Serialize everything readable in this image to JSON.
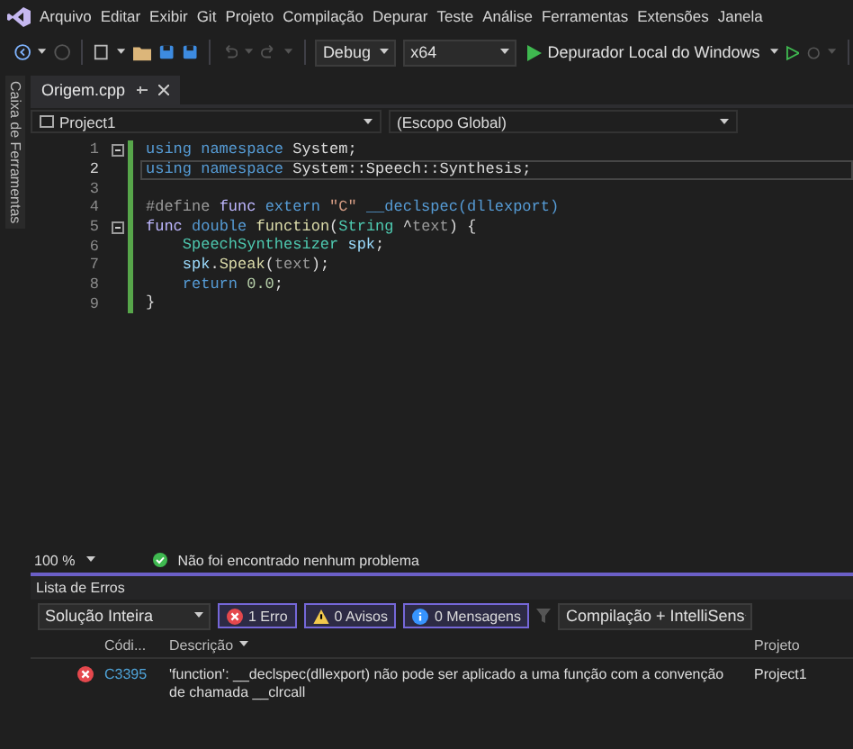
{
  "menu": [
    "Arquivo",
    "Editar",
    "Exibir",
    "Git",
    "Projeto",
    "Compilação",
    "Depurar",
    "Teste",
    "Análise",
    "Ferramentas",
    "Extensões",
    "Janela"
  ],
  "toolbar": {
    "configuration": "Debug",
    "platform": "x64",
    "run_target": "Depurador Local do Windows"
  },
  "side_panel": {
    "label": "Caixa de Ferramentas"
  },
  "tabs": [
    {
      "label": "Origem.cpp",
      "selected": true
    }
  ],
  "navigation": {
    "project": "Project1",
    "scope": "(Escopo Global)"
  },
  "code": [
    {
      "number": "1",
      "foldable": true,
      "current": false,
      "tokens": [
        {
          "kind": "keyword",
          "text": "using "
        },
        {
          "kind": "keyword",
          "text": "namespace "
        },
        {
          "kind": "plain",
          "text": "System;"
        }
      ]
    },
    {
      "number": "2",
      "foldable": false,
      "current": true,
      "tokens": [
        {
          "kind": "keyword",
          "text": "using "
        },
        {
          "kind": "keyword",
          "text": "namespace "
        },
        {
          "kind": "plain",
          "text": "System::Speech::Synthesis;"
        }
      ]
    },
    {
      "number": "3",
      "foldable": false,
      "current": false
    },
    {
      "number": "4",
      "foldable": false,
      "current": false,
      "tokens": [
        {
          "kind": "preprocessor",
          "text": "#define "
        },
        {
          "kind": "macro",
          "text": "func "
        },
        {
          "kind": "keyword",
          "text": "extern "
        },
        {
          "kind": "string",
          "text": "\"C\" "
        },
        {
          "kind": "keyword",
          "text": "__declspec(dllexport)"
        }
      ]
    },
    {
      "number": "5",
      "foldable": true,
      "current": false,
      "tokens": [
        {
          "kind": "macro",
          "text": "func "
        },
        {
          "kind": "keyword",
          "text": "double "
        },
        {
          "kind": "function",
          "text": "function"
        },
        {
          "kind": "plain",
          "text": "("
        },
        {
          "kind": "type",
          "text": "String "
        },
        {
          "kind": "plain",
          "text": "^"
        },
        {
          "kind": "param",
          "text": "text"
        },
        {
          "kind": "plain",
          "text": ") {"
        }
      ]
    },
    {
      "number": "6",
      "foldable": false,
      "current": false,
      "tokens": [
        {
          "kind": "type",
          "text": "    SpeechSynthesizer "
        },
        {
          "kind": "variable",
          "text": "spk"
        },
        {
          "kind": "plain",
          "text": ";"
        }
      ]
    },
    {
      "number": "7",
      "foldable": false,
      "current": false,
      "tokens": [
        {
          "kind": "variable",
          "text": "    spk"
        },
        {
          "kind": "plain",
          "text": "."
        },
        {
          "kind": "function",
          "text": "Speak"
        },
        {
          "kind": "plain",
          "text": "("
        },
        {
          "kind": "param",
          "text": "text"
        },
        {
          "kind": "plain",
          "text": ");"
        }
      ]
    },
    {
      "number": "8",
      "foldable": false,
      "current": false,
      "tokens": [
        {
          "kind": "keyword",
          "text": "    return "
        },
        {
          "kind": "number",
          "text": "0.0"
        },
        {
          "kind": "plain",
          "text": ";"
        }
      ]
    },
    {
      "number": "9",
      "foldable": false,
      "current": false,
      "tokens": [
        {
          "kind": "plain",
          "text": "}"
        }
      ]
    }
  ],
  "status": {
    "zoom": "100 %",
    "message": "Não foi encontrado nenhum problema"
  },
  "error_list": {
    "title": "Lista de Erros",
    "scope": "Solução Inteira",
    "filters": [
      {
        "kind": "error",
        "label": "1 Erro",
        "selected": true
      },
      {
        "kind": "warning",
        "label": "0 Avisos",
        "selected": true
      },
      {
        "kind": "message",
        "label": "0 Mensagens",
        "selected": true
      }
    ],
    "source": "Compilação + IntelliSens",
    "columns": [
      "Códi...",
      "Descrição",
      "Projeto"
    ],
    "rows": [
      {
        "kind": "error",
        "code": "C3395",
        "description": "'function': __declspec(dllexport) não pode ser aplicado a uma função com a convenção de chamada __clrcall",
        "project": "Project1"
      }
    ]
  }
}
